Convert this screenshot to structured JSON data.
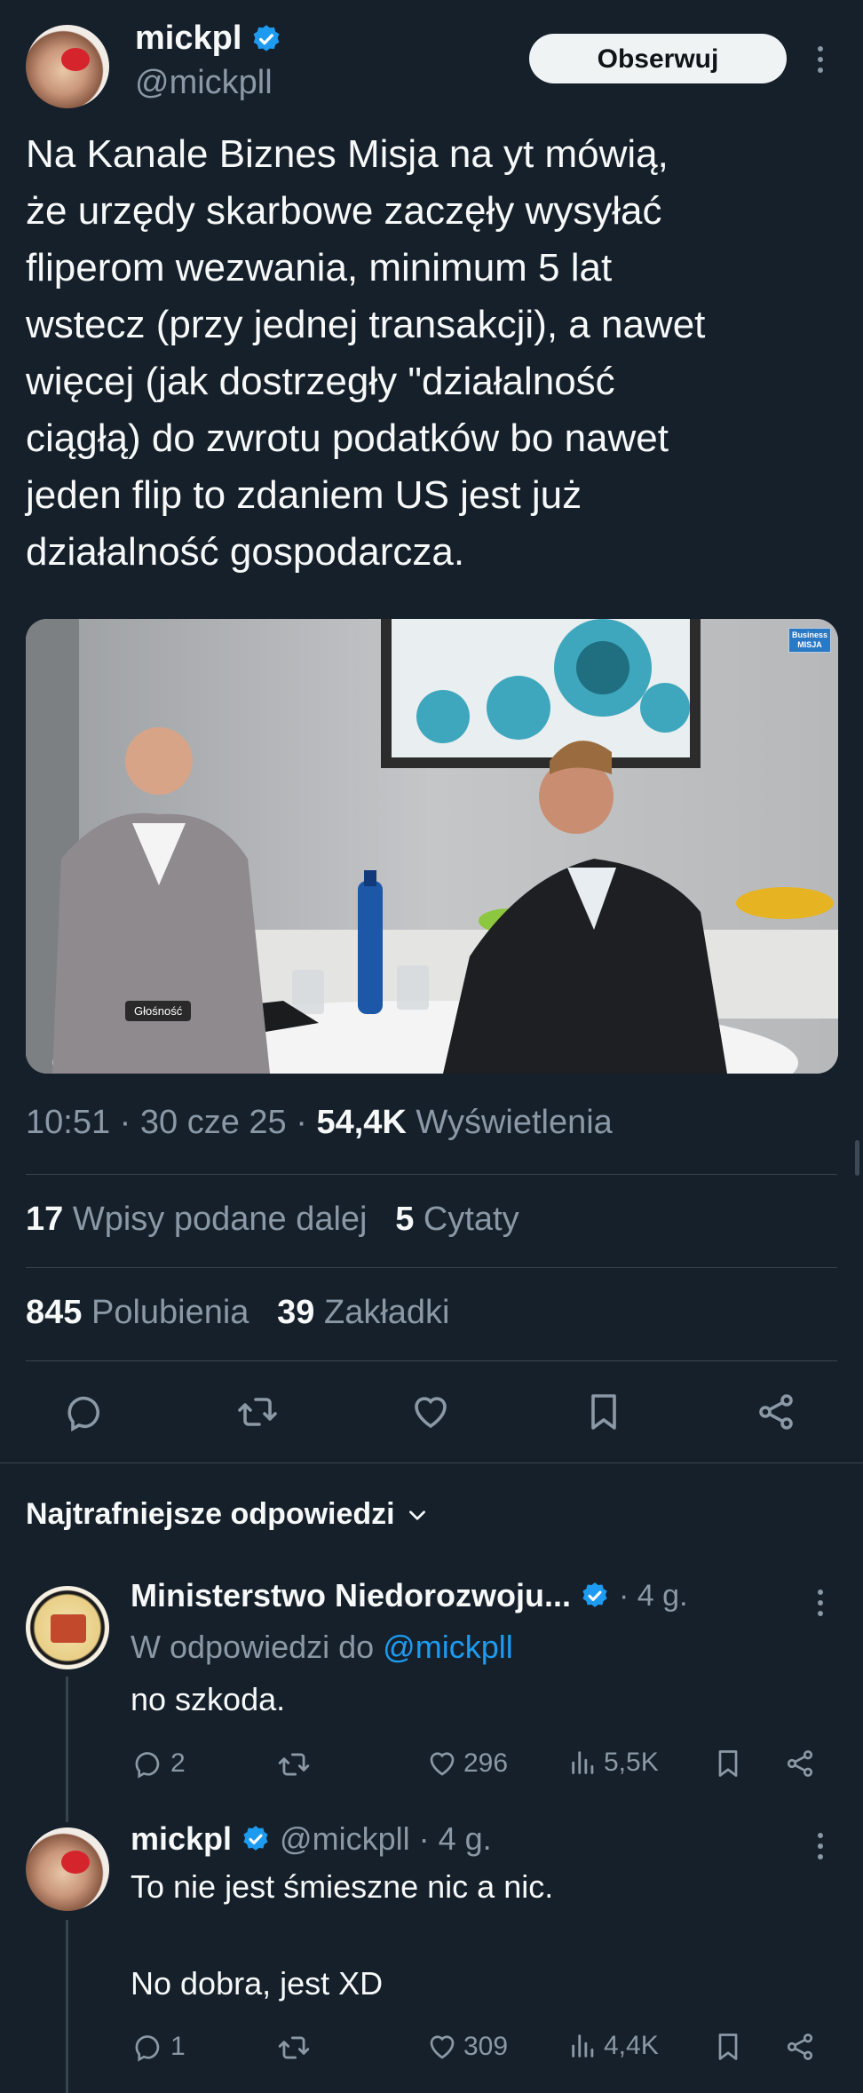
{
  "author": {
    "display_name": "mickpl",
    "handle": "@mickpll",
    "follow_label": "Obserwuj",
    "avatar_icon": "avatar-photo"
  },
  "tweet": {
    "text": "Na Kanale Biznes Misja na yt mówią,\nże urzędy skarbowe zaczęły wysyłać\nfliperom wezwania, minimum 5 lat\nwstecz (przy jednej transakcji), a nawet\nwięcej (jak dostrzegły \"działalność\nciągłą) do zwrotu podatków bo nawet\njeden flip to zdaniem US jest już\ndziałalność gospodarcza.",
    "media": {
      "badge_top": "Business",
      "badge_bottom": "MISJA",
      "caption": "Głośność"
    },
    "time": "10:51",
    "date": "30 cze 25",
    "views_count": "54,4K",
    "views_label": "Wyświetlenia",
    "reposts_count": "17",
    "reposts_label": "Wpisy podane dalej",
    "quotes_count": "5",
    "quotes_label": "Cytaty",
    "likes_count": "845",
    "likes_label": "Polubienia",
    "bookmarks_count": "39",
    "bookmarks_label": "Zakładki"
  },
  "replies_sort_label": "Najtrafniejsze odpowiedzi",
  "replies": [
    {
      "name": "Ministerstwo Niedorozwoju...",
      "time": "· 4 g.",
      "reply_to_prefix": "W odpowiedzi do",
      "reply_to_handle": "@mickpll",
      "text": "no szkoda.",
      "comments": "2",
      "likes": "296",
      "views": "5,5K"
    },
    {
      "name": "mickpl",
      "handle_time": "@mickpll · 4 g.",
      "text_line1": "To nie jest śmieszne nic a nic.",
      "text_line2": "No dobra, jest XD",
      "comments": "1",
      "likes": "309",
      "views": "4,4K"
    }
  ],
  "colors": {
    "background": "#15202b",
    "text": "#f7f9f9",
    "muted": "#8b98a5",
    "accent": "#1d9bf0",
    "divider": "#38444d"
  }
}
